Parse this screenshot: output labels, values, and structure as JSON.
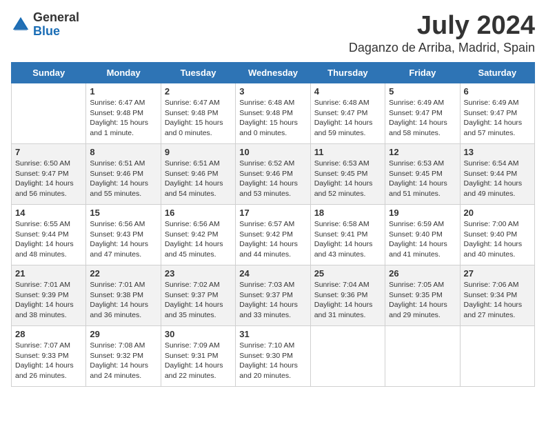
{
  "header": {
    "logo_general": "General",
    "logo_blue": "Blue",
    "title": "July 2024",
    "subtitle": "Daganzo de Arriba, Madrid, Spain"
  },
  "columns": [
    "Sunday",
    "Monday",
    "Tuesday",
    "Wednesday",
    "Thursday",
    "Friday",
    "Saturday"
  ],
  "weeks": [
    [
      {
        "day": "",
        "sunrise": "",
        "sunset": "",
        "daylight": ""
      },
      {
        "day": "1",
        "sunrise": "Sunrise: 6:47 AM",
        "sunset": "Sunset: 9:48 PM",
        "daylight": "Daylight: 15 hours and 1 minute."
      },
      {
        "day": "2",
        "sunrise": "Sunrise: 6:47 AM",
        "sunset": "Sunset: 9:48 PM",
        "daylight": "Daylight: 15 hours and 0 minutes."
      },
      {
        "day": "3",
        "sunrise": "Sunrise: 6:48 AM",
        "sunset": "Sunset: 9:48 PM",
        "daylight": "Daylight: 15 hours and 0 minutes."
      },
      {
        "day": "4",
        "sunrise": "Sunrise: 6:48 AM",
        "sunset": "Sunset: 9:47 PM",
        "daylight": "Daylight: 14 hours and 59 minutes."
      },
      {
        "day": "5",
        "sunrise": "Sunrise: 6:49 AM",
        "sunset": "Sunset: 9:47 PM",
        "daylight": "Daylight: 14 hours and 58 minutes."
      },
      {
        "day": "6",
        "sunrise": "Sunrise: 6:49 AM",
        "sunset": "Sunset: 9:47 PM",
        "daylight": "Daylight: 14 hours and 57 minutes."
      }
    ],
    [
      {
        "day": "7",
        "sunrise": "Sunrise: 6:50 AM",
        "sunset": "Sunset: 9:47 PM",
        "daylight": "Daylight: 14 hours and 56 minutes."
      },
      {
        "day": "8",
        "sunrise": "Sunrise: 6:51 AM",
        "sunset": "Sunset: 9:46 PM",
        "daylight": "Daylight: 14 hours and 55 minutes."
      },
      {
        "day": "9",
        "sunrise": "Sunrise: 6:51 AM",
        "sunset": "Sunset: 9:46 PM",
        "daylight": "Daylight: 14 hours and 54 minutes."
      },
      {
        "day": "10",
        "sunrise": "Sunrise: 6:52 AM",
        "sunset": "Sunset: 9:46 PM",
        "daylight": "Daylight: 14 hours and 53 minutes."
      },
      {
        "day": "11",
        "sunrise": "Sunrise: 6:53 AM",
        "sunset": "Sunset: 9:45 PM",
        "daylight": "Daylight: 14 hours and 52 minutes."
      },
      {
        "day": "12",
        "sunrise": "Sunrise: 6:53 AM",
        "sunset": "Sunset: 9:45 PM",
        "daylight": "Daylight: 14 hours and 51 minutes."
      },
      {
        "day": "13",
        "sunrise": "Sunrise: 6:54 AM",
        "sunset": "Sunset: 9:44 PM",
        "daylight": "Daylight: 14 hours and 49 minutes."
      }
    ],
    [
      {
        "day": "14",
        "sunrise": "Sunrise: 6:55 AM",
        "sunset": "Sunset: 9:44 PM",
        "daylight": "Daylight: 14 hours and 48 minutes."
      },
      {
        "day": "15",
        "sunrise": "Sunrise: 6:56 AM",
        "sunset": "Sunset: 9:43 PM",
        "daylight": "Daylight: 14 hours and 47 minutes."
      },
      {
        "day": "16",
        "sunrise": "Sunrise: 6:56 AM",
        "sunset": "Sunset: 9:42 PM",
        "daylight": "Daylight: 14 hours and 45 minutes."
      },
      {
        "day": "17",
        "sunrise": "Sunrise: 6:57 AM",
        "sunset": "Sunset: 9:42 PM",
        "daylight": "Daylight: 14 hours and 44 minutes."
      },
      {
        "day": "18",
        "sunrise": "Sunrise: 6:58 AM",
        "sunset": "Sunset: 9:41 PM",
        "daylight": "Daylight: 14 hours and 43 minutes."
      },
      {
        "day": "19",
        "sunrise": "Sunrise: 6:59 AM",
        "sunset": "Sunset: 9:40 PM",
        "daylight": "Daylight: 14 hours and 41 minutes."
      },
      {
        "day": "20",
        "sunrise": "Sunrise: 7:00 AM",
        "sunset": "Sunset: 9:40 PM",
        "daylight": "Daylight: 14 hours and 40 minutes."
      }
    ],
    [
      {
        "day": "21",
        "sunrise": "Sunrise: 7:01 AM",
        "sunset": "Sunset: 9:39 PM",
        "daylight": "Daylight: 14 hours and 38 minutes."
      },
      {
        "day": "22",
        "sunrise": "Sunrise: 7:01 AM",
        "sunset": "Sunset: 9:38 PM",
        "daylight": "Daylight: 14 hours and 36 minutes."
      },
      {
        "day": "23",
        "sunrise": "Sunrise: 7:02 AM",
        "sunset": "Sunset: 9:37 PM",
        "daylight": "Daylight: 14 hours and 35 minutes."
      },
      {
        "day": "24",
        "sunrise": "Sunrise: 7:03 AM",
        "sunset": "Sunset: 9:37 PM",
        "daylight": "Daylight: 14 hours and 33 minutes."
      },
      {
        "day": "25",
        "sunrise": "Sunrise: 7:04 AM",
        "sunset": "Sunset: 9:36 PM",
        "daylight": "Daylight: 14 hours and 31 minutes."
      },
      {
        "day": "26",
        "sunrise": "Sunrise: 7:05 AM",
        "sunset": "Sunset: 9:35 PM",
        "daylight": "Daylight: 14 hours and 29 minutes."
      },
      {
        "day": "27",
        "sunrise": "Sunrise: 7:06 AM",
        "sunset": "Sunset: 9:34 PM",
        "daylight": "Daylight: 14 hours and 27 minutes."
      }
    ],
    [
      {
        "day": "28",
        "sunrise": "Sunrise: 7:07 AM",
        "sunset": "Sunset: 9:33 PM",
        "daylight": "Daylight: 14 hours and 26 minutes."
      },
      {
        "day": "29",
        "sunrise": "Sunrise: 7:08 AM",
        "sunset": "Sunset: 9:32 PM",
        "daylight": "Daylight: 14 hours and 24 minutes."
      },
      {
        "day": "30",
        "sunrise": "Sunrise: 7:09 AM",
        "sunset": "Sunset: 9:31 PM",
        "daylight": "Daylight: 14 hours and 22 minutes."
      },
      {
        "day": "31",
        "sunrise": "Sunrise: 7:10 AM",
        "sunset": "Sunset: 9:30 PM",
        "daylight": "Daylight: 14 hours and 20 minutes."
      },
      {
        "day": "",
        "sunrise": "",
        "sunset": "",
        "daylight": ""
      },
      {
        "day": "",
        "sunrise": "",
        "sunset": "",
        "daylight": ""
      },
      {
        "day": "",
        "sunrise": "",
        "sunset": "",
        "daylight": ""
      }
    ]
  ]
}
